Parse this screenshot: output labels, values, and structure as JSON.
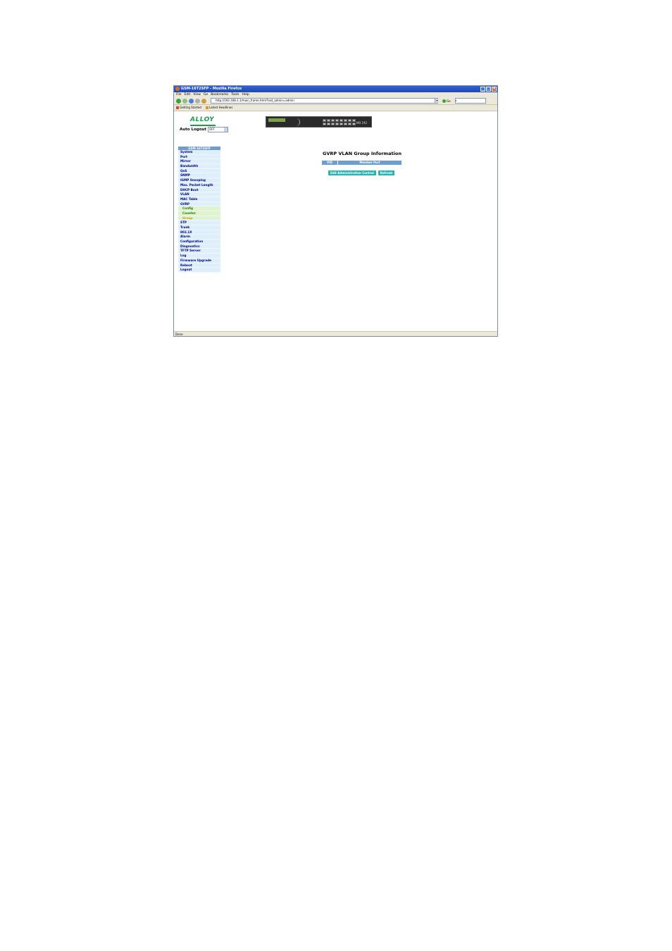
{
  "window": {
    "title": "GSM-16T2SFP - Mozilla Firefox",
    "controls": [
      "_",
      "□",
      "X"
    ]
  },
  "menu": [
    "File",
    "Edit",
    "View",
    "Go",
    "Bookmarks",
    "Tools",
    "Help"
  ],
  "address": {
    "url": "http://192.168.1.1/main_frame.html?last_admin=admin",
    "go_label": "Go"
  },
  "bookmarks": [
    "Getting Started",
    "Latest Headlines"
  ],
  "header": {
    "logo": "ALLOY",
    "auto_logout_label": "Auto Logout",
    "auto_logout_value": "OFF",
    "device_tag": "MB 192"
  },
  "sidebar": {
    "title": "GSM-16T2SFP",
    "items": [
      {
        "label": "System",
        "type": "item"
      },
      {
        "label": "Port",
        "type": "item"
      },
      {
        "label": "Mirror",
        "type": "item"
      },
      {
        "label": "Bandwidth",
        "type": "item"
      },
      {
        "label": "QoS",
        "type": "item"
      },
      {
        "label": "SNMP",
        "type": "item"
      },
      {
        "label": "IGMP Snooping",
        "type": "item"
      },
      {
        "label": "Max. Packet Length",
        "type": "item"
      },
      {
        "label": "DHCP Boot",
        "type": "item"
      },
      {
        "label": "VLAN",
        "type": "item"
      },
      {
        "label": "MAC Table",
        "type": "item"
      },
      {
        "label": "GVRP",
        "type": "item"
      },
      {
        "label": "Config",
        "type": "sub"
      },
      {
        "label": "Counter",
        "type": "sub"
      },
      {
        "label": "Group",
        "type": "sub-active"
      },
      {
        "label": "STP",
        "type": "item"
      },
      {
        "label": "Trunk",
        "type": "item"
      },
      {
        "label": "802.1X",
        "type": "item"
      },
      {
        "label": "Alarm",
        "type": "item"
      },
      {
        "label": "Configuration",
        "type": "item"
      },
      {
        "label": "Diagnostics",
        "type": "item"
      },
      {
        "label": "TFTP Server",
        "type": "item"
      },
      {
        "label": "Log",
        "type": "item"
      },
      {
        "label": "Firmware Upgrade",
        "type": "item"
      },
      {
        "label": "Reboot",
        "type": "item"
      },
      {
        "label": "Logout",
        "type": "item"
      }
    ]
  },
  "main": {
    "title": "GVRP VLAN Group Information",
    "columns": [
      "VID",
      "Member Port"
    ],
    "buttons": [
      "Edit Administration Control",
      "Refresh"
    ]
  },
  "status": "Done",
  "colors": {
    "sidebar_bg": "#dfeefb",
    "header_blue": "#6e9ed1",
    "button_teal": "#23b7b3",
    "logo_green": "#18a14a"
  }
}
